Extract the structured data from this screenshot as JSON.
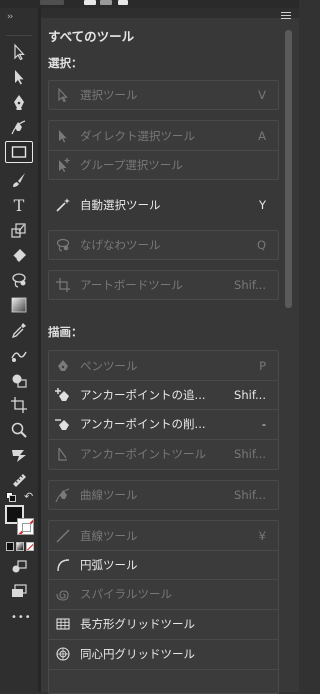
{
  "toolbar": {
    "collapse_label": "››",
    "tools": [
      {
        "icon": "selection-arrow-icon"
      },
      {
        "icon": "direct-selection-arrow-icon"
      },
      {
        "icon": "pen-icon"
      },
      {
        "icon": "curvature-icon"
      },
      {
        "icon": "rectangle-icon",
        "active": true
      },
      {
        "icon": "paintbrush-icon"
      },
      {
        "icon": "type-icon",
        "text": "T"
      },
      {
        "icon": "scale-icon"
      },
      {
        "icon": "eraser-icon"
      },
      {
        "icon": "lasso-icon"
      },
      {
        "icon": "gradient-icon"
      },
      {
        "icon": "eyedropper-icon"
      },
      {
        "icon": "blend-icon"
      },
      {
        "icon": "shape-builder-icon"
      },
      {
        "icon": "artboard-icon"
      },
      {
        "icon": "zoom-icon"
      },
      {
        "icon": "puppet-warp-icon"
      },
      {
        "icon": "ruler-icon"
      }
    ],
    "more_label": "•••"
  },
  "panel": {
    "title": "すべてのツール",
    "sections": {
      "select": "選択：",
      "draw": "描画："
    },
    "groups": [
      {
        "items": [
          {
            "label": "選択ツール",
            "key": "V",
            "icon": "selection-arrow-icon",
            "enabled": false
          }
        ]
      },
      {
        "items": [
          {
            "label": "ダイレクト選択ツール",
            "key": "A",
            "icon": "direct-selection-arrow-icon",
            "enabled": false
          },
          {
            "label": "グループ選択ツール",
            "key": "",
            "icon": "group-selection-icon",
            "enabled": false
          }
        ]
      },
      {
        "items": [
          {
            "label": "自動選択ツール",
            "key": "Y",
            "icon": "magic-wand-icon",
            "enabled": true
          }
        ],
        "noborder": true
      },
      {
        "items": [
          {
            "label": "なげなわツール",
            "key": "Q",
            "icon": "lasso-icon",
            "enabled": false
          }
        ]
      },
      {
        "items": [
          {
            "label": "アートボードツール",
            "key": "Shif...",
            "icon": "artboard-icon",
            "enabled": false
          }
        ]
      },
      {
        "items": [
          {
            "label": "ペンツール",
            "key": "P",
            "icon": "pen-icon",
            "enabled": false
          },
          {
            "label": "アンカーポイントの追...",
            "key": "Shif...",
            "icon": "add-anchor-icon",
            "enabled": true
          },
          {
            "label": "アンカーポイントの削...",
            "key": "-",
            "icon": "delete-anchor-icon",
            "enabled": true
          },
          {
            "label": "アンカーポイントツール",
            "key": "Shif...",
            "icon": "anchor-point-icon",
            "enabled": false
          }
        ]
      },
      {
        "items": [
          {
            "label": "曲線ツール",
            "key": "Shif...",
            "icon": "curvature-icon",
            "enabled": false
          }
        ]
      },
      {
        "items": [
          {
            "label": "直線ツール",
            "key": "¥",
            "icon": "line-segment-icon",
            "enabled": false
          },
          {
            "label": "円弧ツール",
            "key": "",
            "icon": "arc-icon",
            "enabled": true
          },
          {
            "label": "スパイラルツール",
            "key": "",
            "icon": "spiral-icon",
            "enabled": false
          },
          {
            "label": "長方形グリッドツール",
            "key": "",
            "icon": "rectangular-grid-icon",
            "enabled": true
          },
          {
            "label": "同心円グリッドツール",
            "key": "",
            "icon": "polar-grid-icon",
            "enabled": true
          }
        ]
      }
    ]
  }
}
